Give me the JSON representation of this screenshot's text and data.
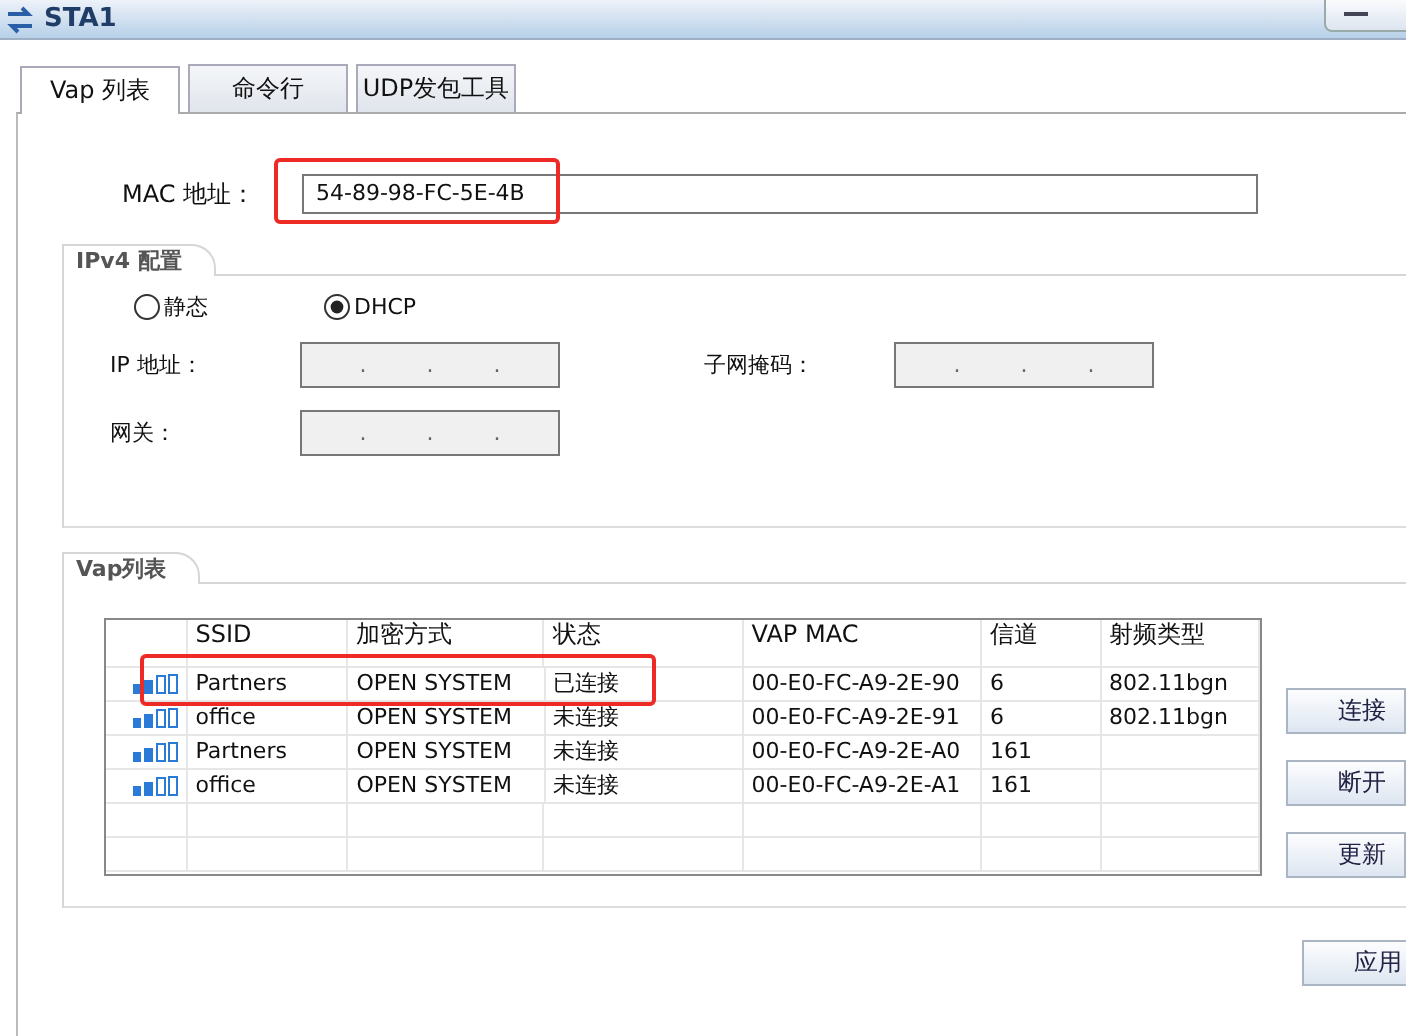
{
  "window": {
    "title": "STA1"
  },
  "tabs": [
    {
      "label": "Vap 列表",
      "selected": true
    },
    {
      "label": "命令行",
      "selected": false
    },
    {
      "label": "UDP发包工具",
      "selected": false
    }
  ],
  "mac": {
    "label": "MAC 地址：",
    "value": "54-89-98-FC-5E-4B"
  },
  "ipv4": {
    "title": "IPv4 配置",
    "modes": [
      {
        "label": "静态",
        "selected": false
      },
      {
        "label": "DHCP",
        "selected": true
      }
    ],
    "fields": [
      {
        "label": "IP 地址：",
        "disabled": true,
        "separators": [
          ".",
          ".",
          "."
        ]
      },
      {
        "label": "子网掩码：",
        "disabled": true,
        "separators": [
          ".",
          ".",
          "."
        ]
      },
      {
        "label": "网关：",
        "disabled": true,
        "separators": [
          ".",
          ".",
          "."
        ]
      }
    ]
  },
  "vap": {
    "title": "Vap列表",
    "columns": [
      "SSID",
      "加密方式",
      "状态",
      "VAP MAC",
      "信道",
      "射频类型"
    ],
    "rows": [
      {
        "ssid": "Partners",
        "encryption": "OPEN SYSTEM",
        "status": "已连接",
        "vap_mac": "00-E0-FC-A9-2E-90",
        "channel": "6",
        "radio_type": "802.11bgn"
      },
      {
        "ssid": "office",
        "encryption": "OPEN SYSTEM",
        "status": "未连接",
        "vap_mac": "00-E0-FC-A9-2E-91",
        "channel": "6",
        "radio_type": "802.11bgn"
      },
      {
        "ssid": "Partners",
        "encryption": "OPEN SYSTEM",
        "status": "未连接",
        "vap_mac": "00-E0-FC-A9-2E-A0",
        "channel": "161"
      },
      {
        "ssid": "office",
        "encryption": "OPEN SYSTEM",
        "status": "未连接",
        "vap_mac": "00-E0-FC-A9-2E-A1",
        "channel": "161"
      }
    ],
    "buttons": [
      "连接",
      "断开",
      "更新"
    ]
  },
  "apply_button": "应用"
}
